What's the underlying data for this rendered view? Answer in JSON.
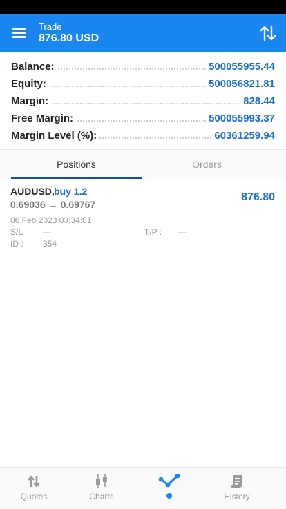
{
  "header": {
    "title": "Trade",
    "subtitle": "876.80 USD",
    "menu_icon": "menu-icon",
    "sort_icon": "sort-icon"
  },
  "summary": {
    "balance": {
      "label": "Balance:",
      "value": "500055955.44"
    },
    "equity": {
      "label": "Equity:",
      "value": "500056821.81"
    },
    "margin": {
      "label": "Margin:",
      "value": "828.44"
    },
    "free_margin": {
      "label": "Free Margin:",
      "value": "500055993.37"
    },
    "margin_level": {
      "label": "Margin Level (%):",
      "value": "60361259.94"
    }
  },
  "tabs": {
    "positions": "Positions",
    "orders": "Orders"
  },
  "position": {
    "symbol": "AUDUSD,",
    "action": "buy 1.2",
    "open_price": "0.69036",
    "arrow": "→",
    "current_price": "0.69767",
    "profit": "876.80",
    "time": "06 Feb 2023 03:34:01",
    "sl_label": "S/L :",
    "sl_value": "—",
    "tp_label": "T/P :",
    "tp_value": "—",
    "id_label": "ID :",
    "id_value": "354"
  },
  "nav": {
    "quotes": "Quotes",
    "charts": "Charts",
    "history": "History"
  },
  "colors": {
    "accent": "#1a86f0",
    "value_blue": "#1a6fd6"
  }
}
